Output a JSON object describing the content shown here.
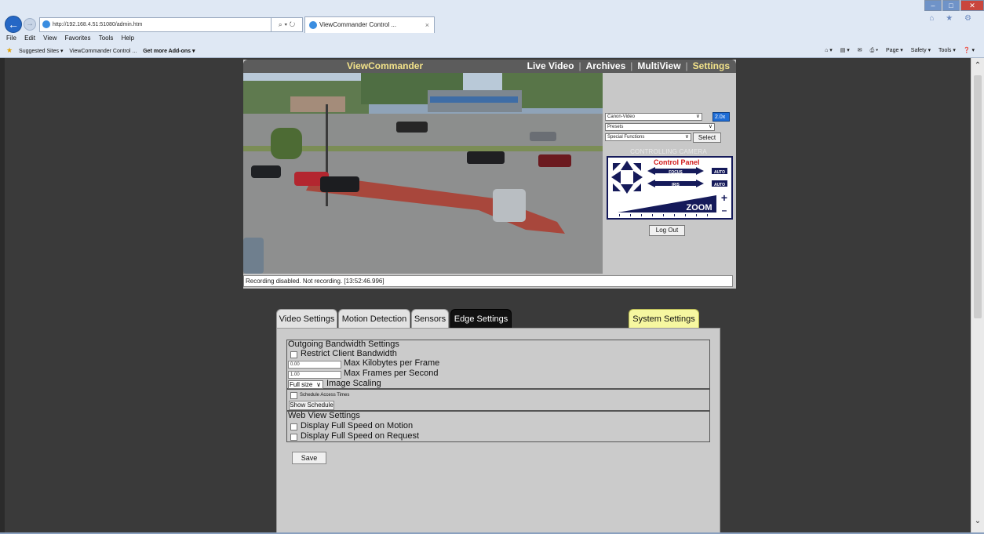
{
  "browser": {
    "url": "http://192.168.4.51:51080/admin.htm",
    "address_tools": "⌕ ▾ ↻",
    "tab_title": "ViewCommander Control ...",
    "tab_close": "×",
    "menu": [
      "File",
      "Edit",
      "View",
      "Favorites",
      "Tools",
      "Help"
    ],
    "favorites": [
      "Suggested Sites ▾",
      "ViewCommander Control ...",
      "Get more Add-ons ▾"
    ],
    "commands": [
      "⌂ ▾",
      "▤ ▾",
      "✉",
      "⎙ ▾",
      "Page ▾",
      "Safety ▾",
      "Tools ▾",
      "❓ ▾"
    ],
    "window_controls": {
      "minimize": "–",
      "maximize": "□",
      "close": "✕"
    },
    "toolbar_icons": "⌂ ★ ⚙",
    "back_glyph": "←",
    "forward_glyph": "→",
    "scroll_up": "⌃",
    "scroll_down": "⌄"
  },
  "app": {
    "title": "ViewCommander",
    "nav": [
      "Live Video",
      "Archives",
      "MultiView",
      "Settings"
    ],
    "active_nav": "Settings",
    "camera_select": "Canon-Video",
    "zoom_select": "2.0x",
    "presets_select": "Presets",
    "special_select": "Special Functions",
    "select_button": "Select",
    "controlling_text": "CONTROLLING CAMERA",
    "control_panel_title": "Control Panel",
    "focus_label": "FOCUS",
    "iris_label": "IRIS",
    "auto_label": "AUTO",
    "zoom_label": "ZOOM",
    "zoom_plus": "+",
    "zoom_minus": "–",
    "logout_button": "Log Out",
    "status_text": "Recording disabled. Not recording. [13:52:46.996]"
  },
  "settings": {
    "tabs": [
      "Video Settings",
      "Motion Detection",
      "Sensors",
      "Edge Settings"
    ],
    "active_tab": "Edge Settings",
    "system_tab": "System Settings",
    "bandwidth_title": "Outgoing Bandwidth Settings",
    "restrict_label": "Restrict Client Bandwidth",
    "max_kb_value": "0.00",
    "max_kb_label": "Max Kilobytes per Frame",
    "max_fps_value": "1.00",
    "max_fps_label": "Max Frames per Second",
    "scaling_value": "Full size",
    "scaling_label": "Image Scaling",
    "schedule_label": "Schedule Access Times",
    "show_schedule_button": "Show Schedule",
    "web_title": "Web View Settings",
    "full_speed_motion_label": "Display Full Speed on Motion",
    "full_speed_request_label": "Display Full Speed on Request",
    "save_button": "Save"
  },
  "colors": {
    "accent_yellow": "#f3e38a",
    "header_bg": "#5c5c5c",
    "control_panel_red": "#d11b1b",
    "control_panel_navy": "#151a5a",
    "system_tab_bg": "#f6f7a0"
  }
}
